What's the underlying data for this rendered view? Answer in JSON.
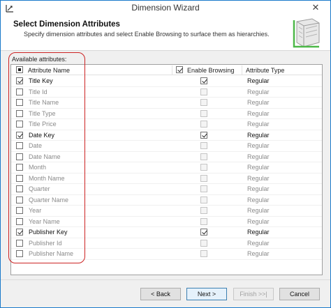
{
  "window": {
    "title": "Dimension Wizard",
    "close_label": "✕"
  },
  "header": {
    "title": "Select Dimension Attributes",
    "subtitle": "Specify dimension attributes and select Enable Browsing to surface them as hierarchies."
  },
  "content": {
    "available_label": "Available attributes:",
    "columns": {
      "name": "Attribute Name",
      "browsing": "Enable Browsing",
      "type": "Attribute Type"
    },
    "rows": [
      {
        "name": "Title Key",
        "checked": true,
        "browsing": true,
        "type": "Regular"
      },
      {
        "name": "Title Id",
        "checked": false,
        "browsing": false,
        "type": "Regular"
      },
      {
        "name": "Title Name",
        "checked": false,
        "browsing": false,
        "type": "Regular"
      },
      {
        "name": "Title Type",
        "checked": false,
        "browsing": false,
        "type": "Regular"
      },
      {
        "name": "Title Price",
        "checked": false,
        "browsing": false,
        "type": "Regular"
      },
      {
        "name": "Date Key",
        "checked": true,
        "browsing": true,
        "type": "Regular"
      },
      {
        "name": "Date",
        "checked": false,
        "browsing": false,
        "type": "Regular"
      },
      {
        "name": "Date Name",
        "checked": false,
        "browsing": false,
        "type": "Regular"
      },
      {
        "name": "Month",
        "checked": false,
        "browsing": false,
        "type": "Regular"
      },
      {
        "name": "Month Name",
        "checked": false,
        "browsing": false,
        "type": "Regular"
      },
      {
        "name": "Quarter",
        "checked": false,
        "browsing": false,
        "type": "Regular"
      },
      {
        "name": "Quarter Name",
        "checked": false,
        "browsing": false,
        "type": "Regular"
      },
      {
        "name": "Year",
        "checked": false,
        "browsing": false,
        "type": "Regular"
      },
      {
        "name": "Year Name",
        "checked": false,
        "browsing": false,
        "type": "Regular"
      },
      {
        "name": "Publisher Key",
        "checked": true,
        "browsing": true,
        "type": "Regular"
      },
      {
        "name": "Publisher Id",
        "checked": false,
        "browsing": false,
        "type": "Regular"
      },
      {
        "name": "Publisher Name",
        "checked": false,
        "browsing": false,
        "type": "Regular"
      }
    ]
  },
  "footer": {
    "back": "< Back",
    "next": "Next >",
    "finish": "Finish >>|",
    "cancel": "Cancel"
  },
  "icons": {
    "app": "wizard-app-icon",
    "header": "dimension-cube-icon"
  },
  "colors": {
    "highlight": "#cc2222",
    "window_border": "#1979ca"
  }
}
